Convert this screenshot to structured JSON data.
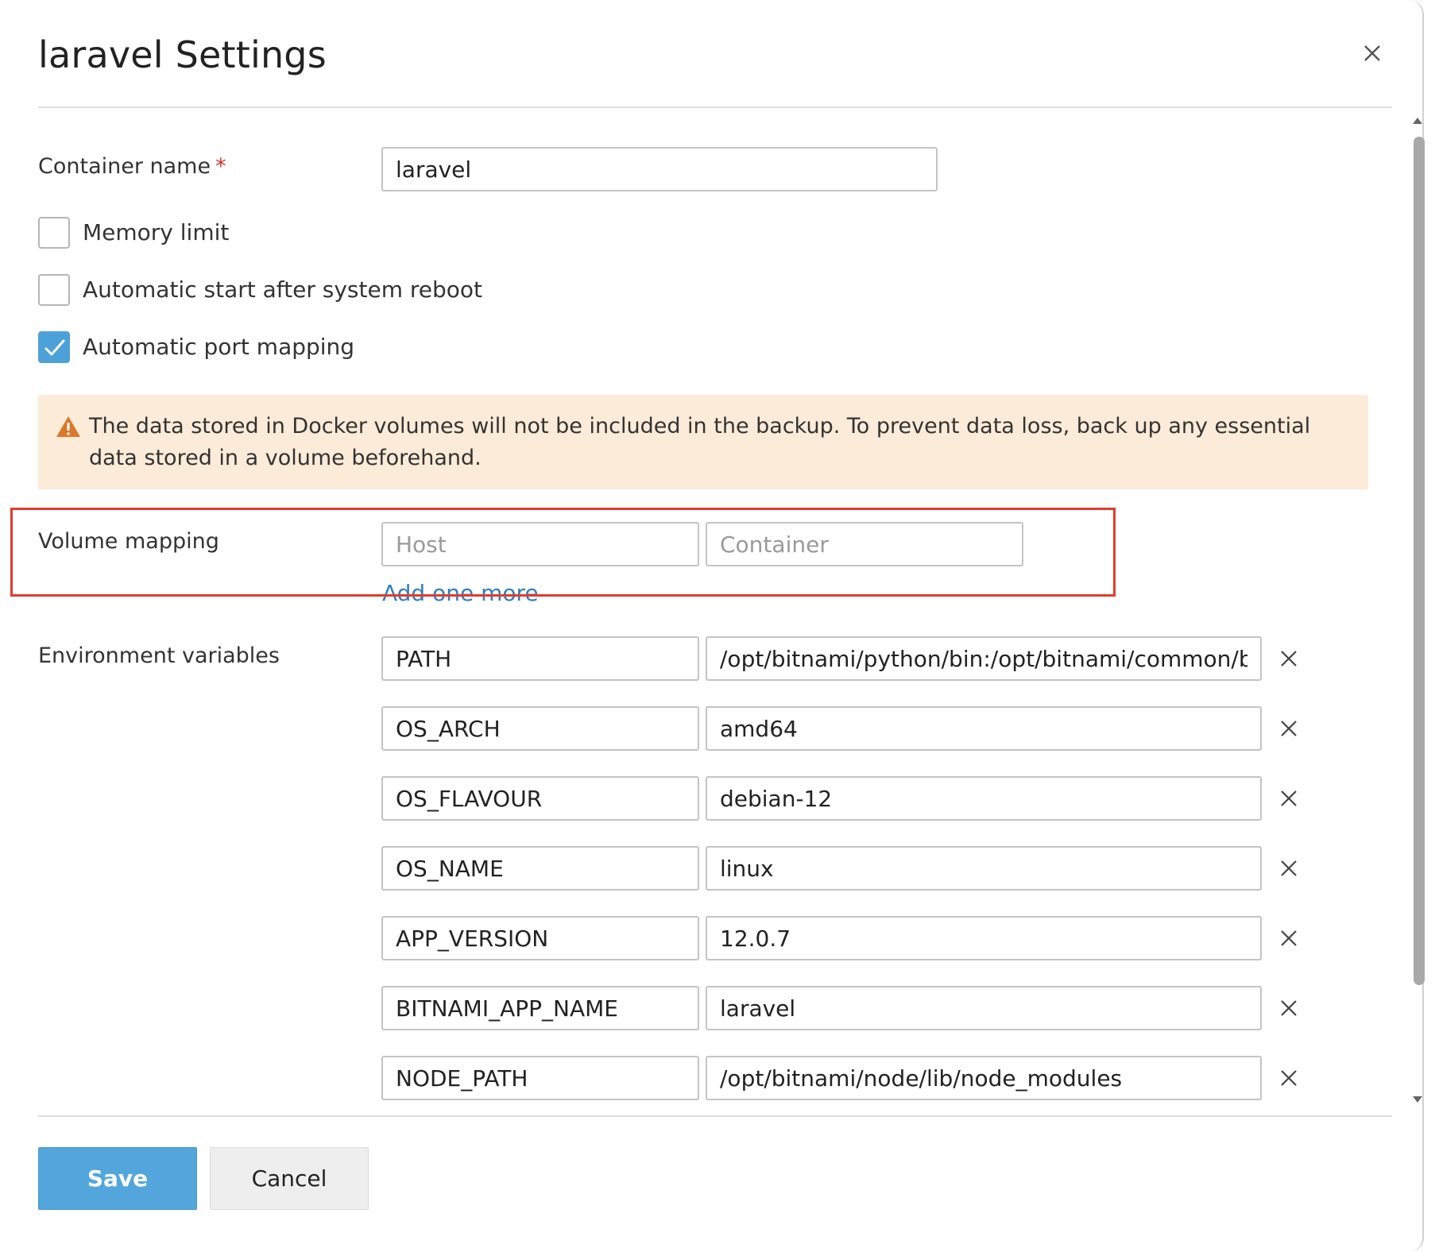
{
  "dialog": {
    "title": "laravel Settings",
    "close_icon": "close-icon"
  },
  "container_name": {
    "label": "Container name",
    "required_mark": "*",
    "value": "laravel"
  },
  "options": {
    "memory_limit": {
      "label": "Memory limit",
      "checked": false
    },
    "auto_start": {
      "label": "Automatic start after system reboot",
      "checked": false
    },
    "auto_port_mapping": {
      "label": "Automatic port mapping",
      "checked": true
    }
  },
  "warning": {
    "icon": "warning-icon",
    "text": "The data stored in Docker volumes will not be included in the backup. To prevent data loss, back up any essential data stored in a volume beforehand."
  },
  "volume_mapping": {
    "label": "Volume mapping",
    "host_placeholder": "Host",
    "container_placeholder": "Container",
    "add_more": "Add one more"
  },
  "environment": {
    "label": "Environment variables",
    "rows": [
      {
        "name": "PATH",
        "value": "/opt/bitnami/python/bin:/opt/bitnami/common/bin"
      },
      {
        "name": "OS_ARCH",
        "value": "amd64"
      },
      {
        "name": "OS_FLAVOUR",
        "value": "debian-12"
      },
      {
        "name": "OS_NAME",
        "value": "linux"
      },
      {
        "name": "APP_VERSION",
        "value": "12.0.7"
      },
      {
        "name": "BITNAMI_APP_NAME",
        "value": "laravel"
      },
      {
        "name": "NODE_PATH",
        "value": "/opt/bitnami/node/lib/node_modules"
      }
    ]
  },
  "footer": {
    "save_label": "Save",
    "cancel_label": "Cancel"
  },
  "colors": {
    "accent": "#4da1d9",
    "warning_bg": "#fcebd8",
    "warning_icon": "#d9782a",
    "highlight": "#e53b2c",
    "link": "#2f7fc1"
  }
}
